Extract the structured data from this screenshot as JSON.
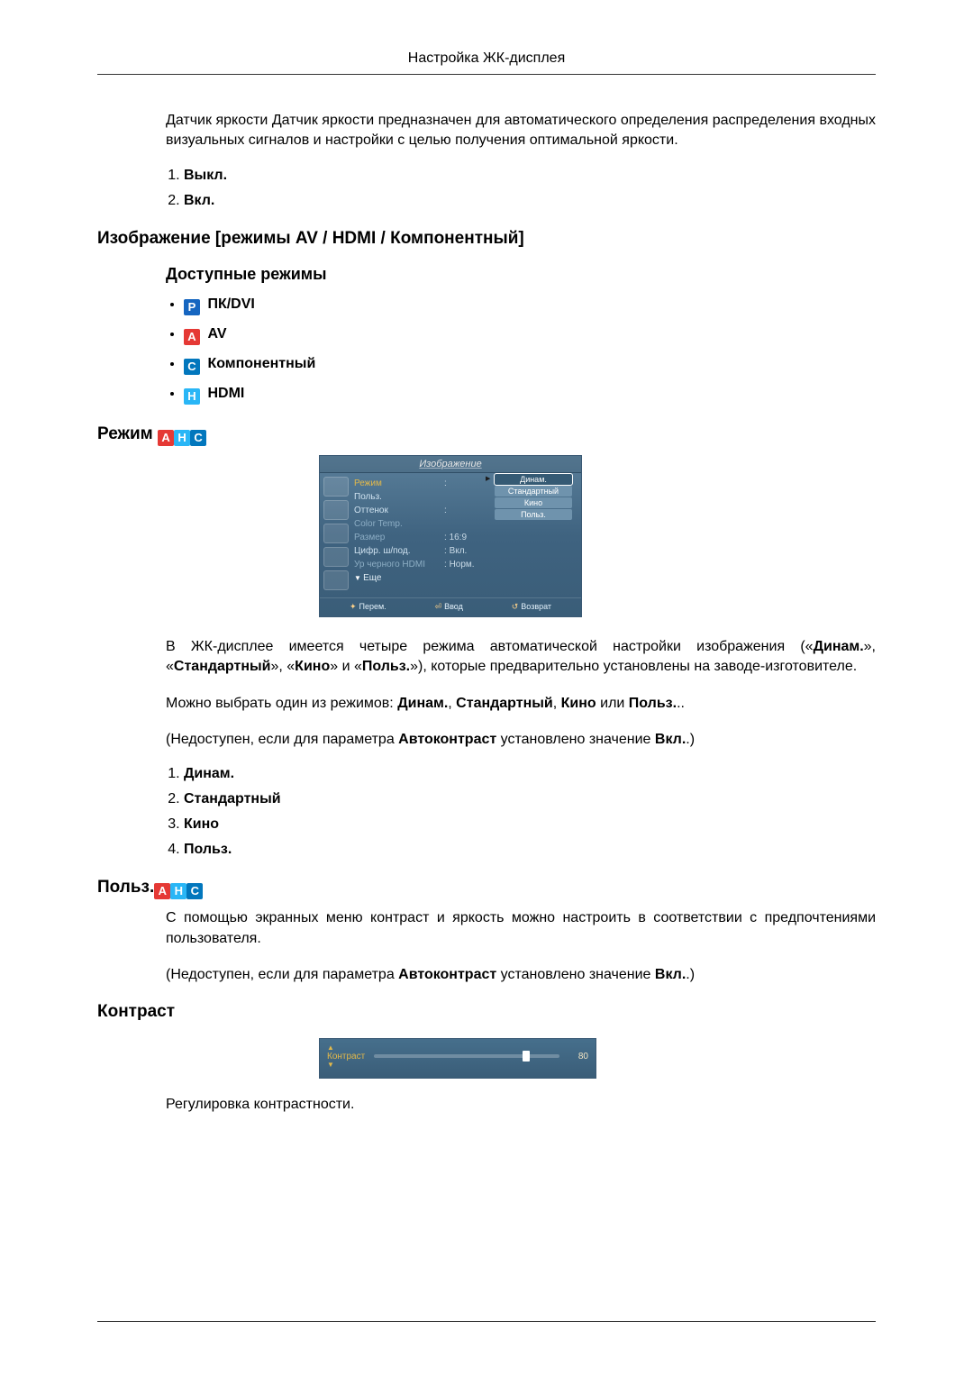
{
  "header": {
    "title": "Настройка ЖК-дисплея"
  },
  "intro": {
    "para": "Датчик яркости Датчик яркости предназначен для автоматического определения распределения входных визуальных сигналов и настройки с целью получения оптимальной яркости.",
    "list": [
      "Выкл.",
      "Вкл."
    ]
  },
  "image_modes": {
    "title": "Изображение [режимы AV / HDMI / Компонентный]",
    "subtitle": "Доступные режимы",
    "items": [
      {
        "badge": "P",
        "badgeClass": "badge-p",
        "label": "ПК/DVI"
      },
      {
        "badge": "A",
        "badgeClass": "badge-a",
        "label": "AV"
      },
      {
        "badge": "C",
        "badgeClass": "badge-c",
        "label": "Компонентный"
      },
      {
        "badge": "H",
        "badgeClass": "badge-h",
        "label": "HDMI"
      }
    ]
  },
  "mode_section": {
    "title": "Режим",
    "badges": [
      "A",
      "H",
      "C"
    ],
    "osd": {
      "title": "Изображение",
      "rows": {
        "mode": "Режим",
        "user": "Польз.",
        "tint": "Оттенок",
        "colortemp": "Color Temp.",
        "size": "Размер",
        "sizeVal": "16:9",
        "dnr": "Цифр. ш/под.",
        "dnrVal": "Вкл.",
        "hdmiblack": "Ур черного HDMI",
        "hdmiblackVal": "Норм.",
        "more": "Еще"
      },
      "options": [
        "Динам.",
        "Стандартный",
        "Кино",
        "Польз."
      ],
      "footer": {
        "move": "Перем.",
        "enter": "Ввод",
        "back": "Возврат"
      }
    },
    "para1_pre": "В ЖК-дисплее имеется четыре режима автоматической настройки изображения («",
    "para1_m1": "Динам.",
    "para1_mid1": "», «",
    "para1_m2": "Стандартный",
    "para1_mid2": "», «",
    "para1_m3": "Кино",
    "para1_mid3": "» и «",
    "para1_m4": "Польз.",
    "para1_post": "»), которые предварительно установлены на заводе-изготовителе.",
    "para2_pre": "Можно выбрать один из режимов: ",
    "para2_post": "..",
    "sep_comma": ", ",
    "sep_or": " или ",
    "para3_pre": "(Недоступен, если для параметра ",
    "para3_b1": "Автоконтраст",
    "para3_mid": " установлено значение ",
    "para3_b2": "Вкл.",
    "para3_post": ".)",
    "list": [
      "Динам.",
      "Стандартный",
      "Кино",
      "Польз."
    ]
  },
  "user_section": {
    "title": "Польз.",
    "badges": [
      "A",
      "H",
      "C"
    ],
    "para1": "С помощью экранных меню контраст и яркость можно настроить в соответствии с предпочтениями пользователя.",
    "para2_pre": "(Недоступен, если для параметра ",
    "para2_b1": "Автоконтраст",
    "para2_mid": " установлено значение ",
    "para2_b2": "Вкл.",
    "para2_post": ".)"
  },
  "contrast_section": {
    "title": "Контраст",
    "slider": {
      "label": "Контраст",
      "value": "80",
      "percent": 80
    },
    "para": "Регулировка контрастности."
  }
}
